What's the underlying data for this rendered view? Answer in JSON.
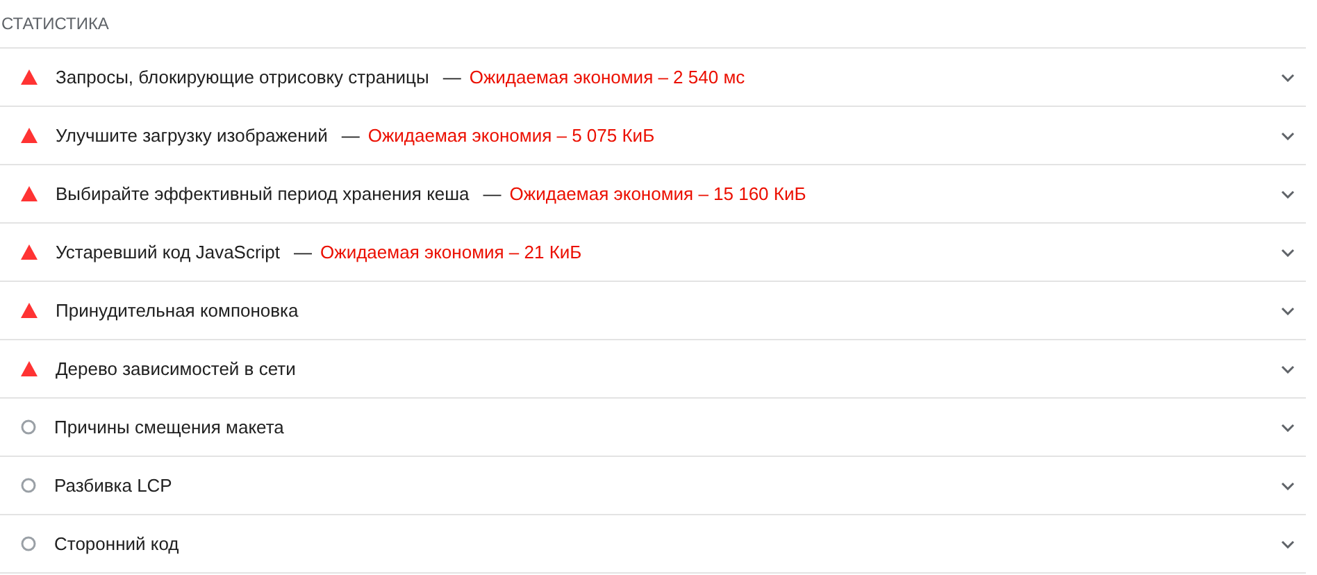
{
  "section": {
    "title": "СТАТИСТИКА"
  },
  "audits": [
    {
      "kind": "fail",
      "title": "Запросы, блокирующие отрисовку страницы",
      "separator": "—",
      "savings": "Ожидаемая экономия – 2 540 мс",
      "expanded": false
    },
    {
      "kind": "fail",
      "title": "Улучшите загрузку изображений",
      "separator": "—",
      "savings": "Ожидаемая экономия – 5 075 КиБ",
      "expanded": false
    },
    {
      "kind": "fail",
      "title": "Выбирайте эффективный период хранения кеша",
      "separator": "—",
      "savings": "Ожидаемая экономия – 15 160 КиБ",
      "expanded": false
    },
    {
      "kind": "fail",
      "title": "Устаревший код JavaScript",
      "separator": "—",
      "savings": "Ожидаемая экономия – 21 КиБ",
      "expanded": false
    },
    {
      "kind": "fail",
      "title": "Принудительная компоновка",
      "expanded": false
    },
    {
      "kind": "fail",
      "title": "Дерево зависимостей в сети",
      "expanded": false
    },
    {
      "kind": "info",
      "title": "Причины смещения макета",
      "expanded": false
    },
    {
      "kind": "info",
      "title": "Разбивка LCP",
      "expanded": false
    },
    {
      "kind": "info",
      "title": "Сторонний код",
      "expanded": false
    }
  ]
}
